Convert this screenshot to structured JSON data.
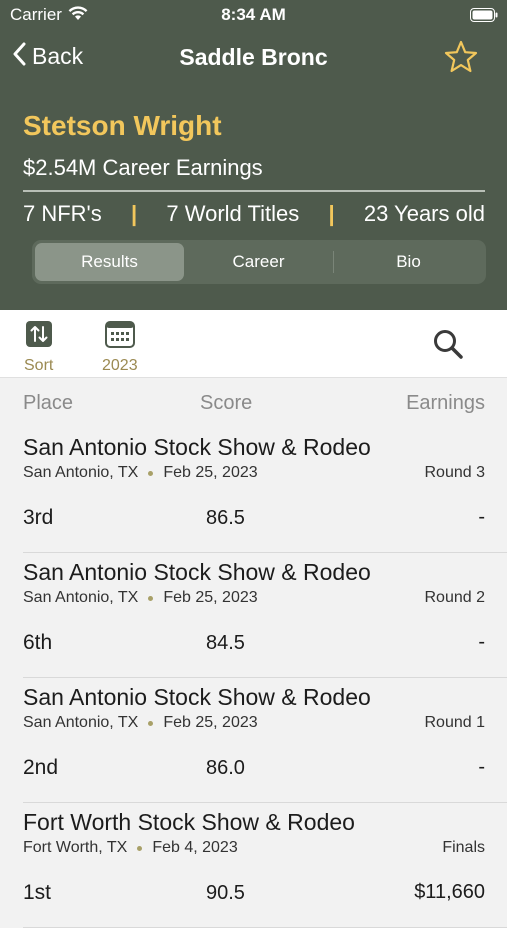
{
  "status_bar": {
    "carrier": "Carrier",
    "time": "8:34 AM"
  },
  "nav": {
    "back_label": "Back",
    "title": "Saddle Bronc"
  },
  "athlete": {
    "name": "Stetson Wright",
    "earnings": "$2.54M Career Earnings",
    "stats": [
      "7 NFR's",
      "7 World Titles",
      "23 Years old"
    ]
  },
  "tabs": [
    {
      "label": "Results",
      "active": true
    },
    {
      "label": "Career",
      "active": false
    },
    {
      "label": "Bio",
      "active": false
    }
  ],
  "toolbar": {
    "sort_label": "Sort",
    "year_label": "2023"
  },
  "columns": {
    "place": "Place",
    "score": "Score",
    "earnings": "Earnings"
  },
  "results": [
    {
      "event": "San Antonio Stock Show & Rodeo",
      "location": "San Antonio, TX",
      "date": "Feb 25, 2023",
      "round": "Round 3",
      "place": "3rd",
      "score": "86.5",
      "earnings": "-"
    },
    {
      "event": "San Antonio Stock Show & Rodeo",
      "location": "San Antonio, TX",
      "date": "Feb 25, 2023",
      "round": "Round 2",
      "place": "6th",
      "score": "84.5",
      "earnings": "-"
    },
    {
      "event": "San Antonio Stock Show & Rodeo",
      "location": "San Antonio, TX",
      "date": "Feb 25, 2023",
      "round": "Round 1",
      "place": "2nd",
      "score": "86.0",
      "earnings": "-"
    },
    {
      "event": "Fort Worth Stock Show & Rodeo",
      "location": "Fort Worth, TX",
      "date": "Feb 4, 2023",
      "round": "Finals",
      "place": "1st",
      "score": "90.5",
      "earnings": "$11,660"
    }
  ],
  "colors": {
    "header_bg": "#4e5a4c",
    "accent_gold": "#f2c75c",
    "toolbar_accent": "#9b8a52"
  }
}
